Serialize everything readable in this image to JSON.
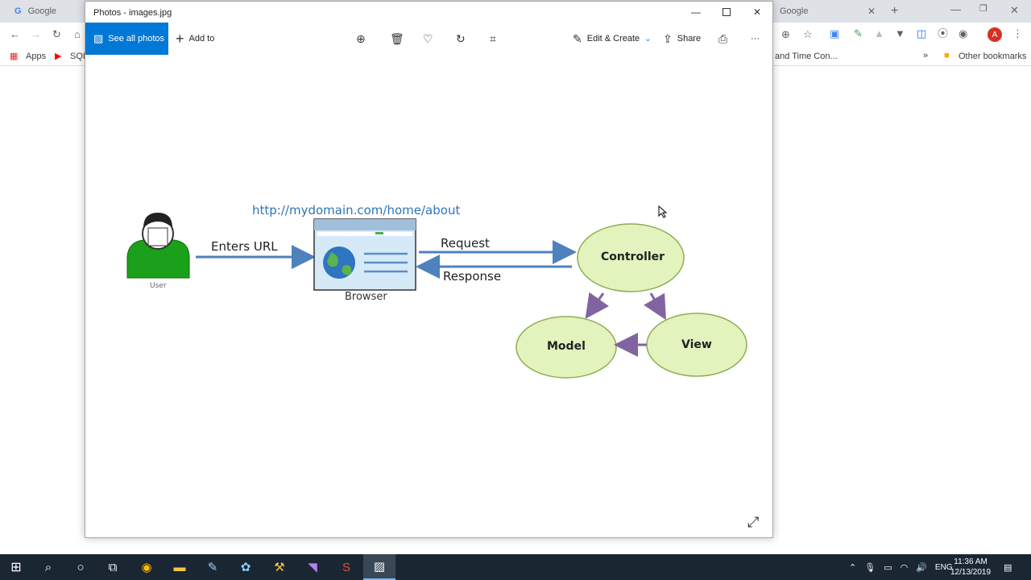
{
  "chrome": {
    "tab1_title": "Google",
    "tab2_title": "Google",
    "bookmarks": {
      "apps": "Apps",
      "sql": "SQL",
      "date_time": "and Time Con...",
      "more": "»",
      "other": "Other bookmarks"
    },
    "avatar_letter": "A"
  },
  "photos": {
    "window_title": "Photos - images.jpg",
    "toolbar": {
      "see_all": "See all photos",
      "add_to": "Add to",
      "edit_create": "Edit & Create",
      "share": "Share",
      "more": "···"
    }
  },
  "diagram": {
    "url": "http://mydomain.com/home/about",
    "user_label": "User",
    "enters_url": "Enters URL",
    "browser_label": "Browser",
    "request": "Request",
    "response": "Response",
    "controller": "Controller",
    "model": "Model",
    "view": "View"
  },
  "taskbar": {
    "lang": "ENG",
    "time": "11:36 AM",
    "date": "12/13/2019"
  },
  "colors": {
    "accent": "#0078d7",
    "url_blue": "#2e75b6",
    "node_fill": "#e3f3bd",
    "node_stroke": "#8fad4f",
    "user_green": "#1aa01a",
    "arrow_blue": "#4f81bd",
    "arrow_purple": "#8064a2"
  }
}
